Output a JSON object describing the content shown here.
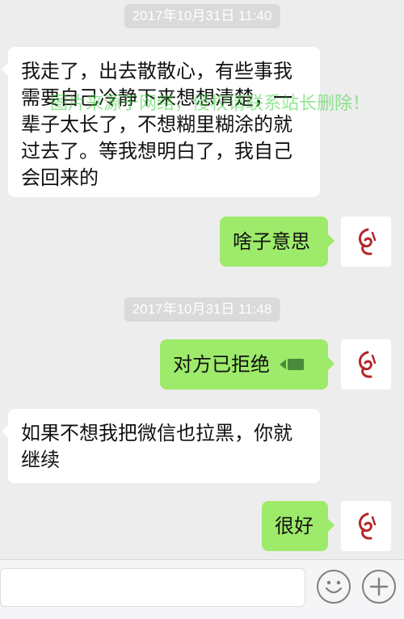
{
  "timestamps": [
    "2017年10月31日 11:40",
    "2017年10月31日 11:48"
  ],
  "messages": [
    {
      "side": "in",
      "text": "我走了，出去散散心，有些事我需要自己冷静下来想想清楚，一辈子太长了，不想糊里糊涂的就过去了。等我想明白了，我自己会回来的"
    },
    {
      "side": "out",
      "text": "啥子意思"
    },
    {
      "side": "out",
      "text": "对方已拒绝",
      "icon": "video-call-icon"
    },
    {
      "side": "in",
      "text": "如果不想我把微信也拉黑，你就继续"
    },
    {
      "side": "out",
      "text": "很好"
    }
  ],
  "watermark": "图片来源于网络，侵权请联系站长删除！",
  "input_bar": {
    "text_field_value": "",
    "buttons": [
      "emoji-icon",
      "plus-icon"
    ]
  },
  "colors": {
    "background": "#ededed",
    "outgoing_bubble": "#9eea6a",
    "incoming_bubble": "#ffffff",
    "timestamp_bg": "#dadada",
    "avatar_logo": "#b3262a",
    "watermark": "#3cd23c"
  }
}
